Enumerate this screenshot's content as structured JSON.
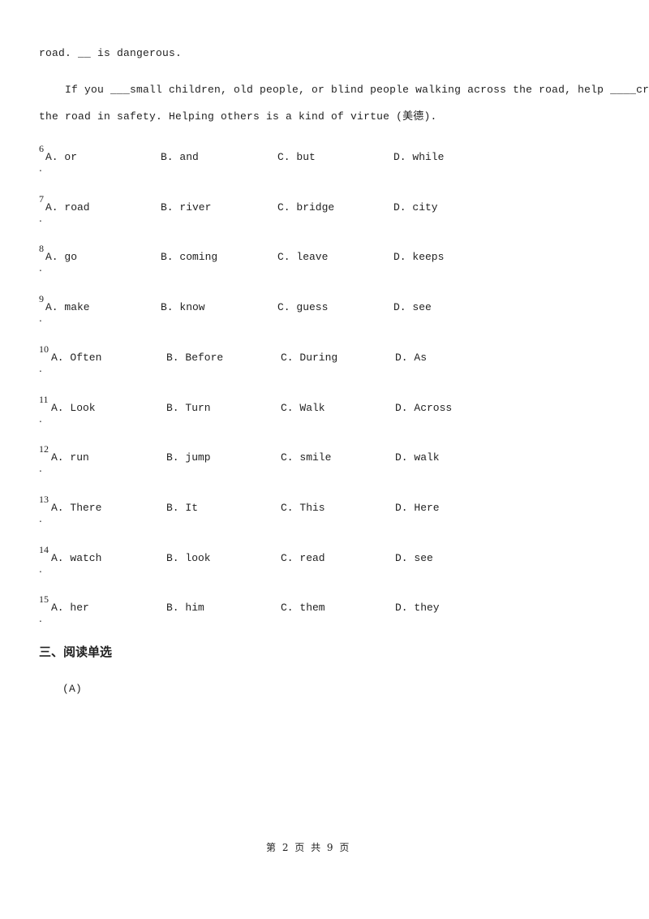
{
  "passage": {
    "line1": "road. __ is dangerous.",
    "line2": "    If you ___small children, old people, or blind people walking across the road, help ____cross",
    "line3": "the road in safety. Helping others is a kind of virtue (美德)."
  },
  "questions": [
    {
      "num": "6",
      "options": [
        "A. or",
        "B. and",
        "C. but",
        "D. while"
      ]
    },
    {
      "num": "7",
      "options": [
        "A. road",
        "B. river",
        "C. bridge",
        "D. city"
      ]
    },
    {
      "num": "8",
      "options": [
        "A. go",
        "B. coming",
        "C. leave",
        "D. keeps"
      ]
    },
    {
      "num": "9",
      "options": [
        "A. make",
        "B. know",
        "C. guess",
        "D. see"
      ]
    },
    {
      "num": "10",
      "options": [
        "A. Often",
        "B. Before",
        "C. During",
        "D. As"
      ]
    },
    {
      "num": "11",
      "options": [
        "A. Look",
        "B. Turn",
        "C. Walk",
        "D. Across"
      ]
    },
    {
      "num": "12",
      "options": [
        "A. run",
        "B. jump",
        "C. smile",
        "D. walk"
      ]
    },
    {
      "num": "13",
      "options": [
        "A. There",
        "B. It",
        "C. This",
        "D. Here"
      ]
    },
    {
      "num": "14",
      "options": [
        "A. watch",
        "B. look",
        "C. read",
        "D. see"
      ]
    },
    {
      "num": "15",
      "options": [
        "A. her",
        "B. him",
        "C. them",
        "D. they"
      ]
    }
  ],
  "section": {
    "heading": "三、阅读单选",
    "subheading": "(A)"
  },
  "footer": {
    "page_label": "第 2 页 共 9 页"
  }
}
